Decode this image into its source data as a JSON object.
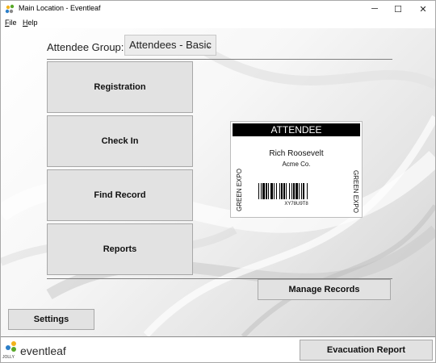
{
  "window": {
    "title": "Main Location - Eventleaf",
    "minimize": "─",
    "maximize": "☐",
    "close": "✕"
  },
  "menu": [
    "File",
    "Help"
  ],
  "group": {
    "label": "Attendee Group:",
    "selected": "Attendees - Basic"
  },
  "actions": {
    "registration": "Registration",
    "check_in": "Check In",
    "find_record": "Find Record",
    "reports": "Reports",
    "manage_records": "Manage Records",
    "settings": "Settings",
    "evacuation_report": "Evacuation Report"
  },
  "badge": {
    "header": "ATTENDEE",
    "name": "Rich Roosevelt",
    "company": "Acme Co.",
    "side_label": "GREEN EXPO",
    "barcode_text": "XY78U9T8"
  },
  "footer": {
    "brand": "eventleaf",
    "brand_small": "JOLLY"
  },
  "colors": {
    "button_face": "#e2e2e2",
    "badge_header": "#000000"
  }
}
